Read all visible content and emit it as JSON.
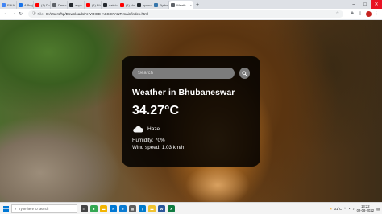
{
  "browser": {
    "tabs": [
      {
        "label": "FINAL",
        "color": "#4285f4"
      },
      {
        "label": "A Proj",
        "color": "#1a73e8"
      },
      {
        "label": "(1) D",
        "color": "#ff0000"
      },
      {
        "label": "Dem",
        "color": "#5f6368"
      },
      {
        "label": "app",
        "color": "#24292e"
      },
      {
        "label": "(1) Bl",
        "color": "#ff0000"
      },
      {
        "label": "datei",
        "color": "#24292e"
      },
      {
        "label": "(1) Ho",
        "color": "#ff0000"
      },
      {
        "label": "open",
        "color": "#24292e"
      },
      {
        "label": "Pytho",
        "color": "#3776ab"
      },
      {
        "label": "Weath",
        "color": "#5f6368",
        "active": true
      }
    ],
    "new_tab_symbol": "+",
    "address": {
      "scheme_label": "File",
      "url": "C:/Users/hp/Downloads/AI-VOICE-ASSISTANT-main/index.html"
    },
    "window_controls": {
      "minimize": "–",
      "maximize": "□",
      "close": "✕"
    }
  },
  "weather": {
    "search_placeholder": "Search",
    "city_line": "Weather in Bhubaneswar",
    "temperature": "34.27°C",
    "description": "Haze",
    "humidity": "Humidity: 70%",
    "wind": "Wind speed: 1.03 km/h",
    "icon": "cloud-icon"
  },
  "taskbar": {
    "search_placeholder": "Type here to search",
    "weather_temp": "31°C",
    "time": "13:22",
    "date": "02-08-2022",
    "apps": [
      {
        "name": "task-view",
        "color": "#444444",
        "glyph": "▭"
      },
      {
        "name": "chrome",
        "color": "#34a853",
        "glyph": "●"
      },
      {
        "name": "folder",
        "color": "#f2b400",
        "glyph": "▬"
      },
      {
        "name": "mail",
        "color": "#0078d4",
        "glyph": "✉"
      },
      {
        "name": "edge",
        "color": "#0a7bd2",
        "glyph": "e"
      },
      {
        "name": "store",
        "color": "#5e5e5e",
        "glyph": "▦"
      },
      {
        "name": "vscode",
        "color": "#007acc",
        "glyph": "⟩"
      },
      {
        "name": "explorer",
        "color": "#f0c330",
        "glyph": "▬"
      },
      {
        "name": "app-blue",
        "color": "#2b579a",
        "glyph": "W"
      },
      {
        "name": "app-green",
        "color": "#107c41",
        "glyph": "X"
      }
    ]
  }
}
